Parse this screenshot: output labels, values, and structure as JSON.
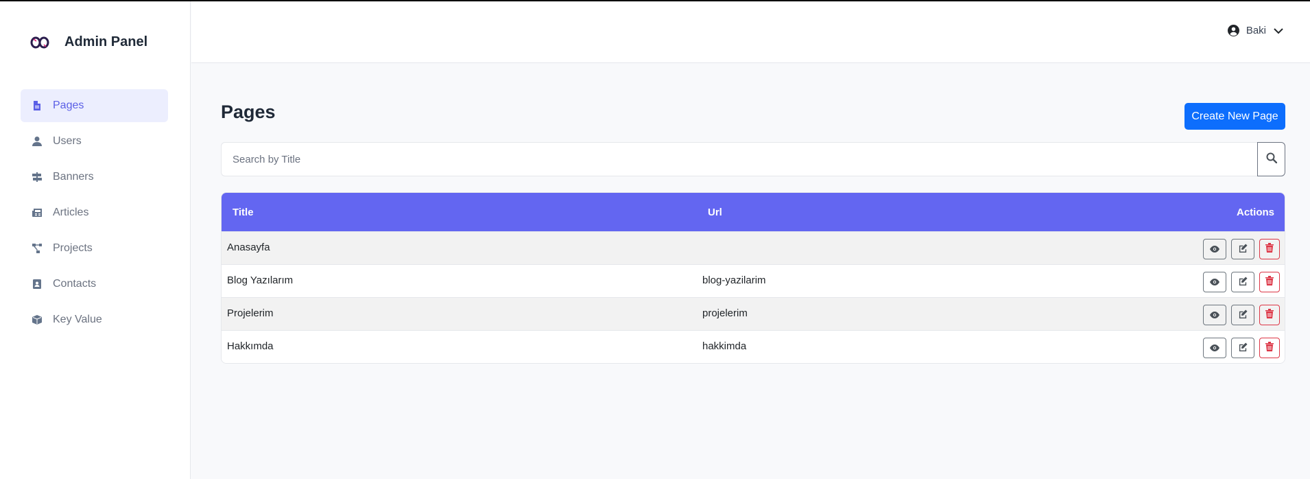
{
  "brand": {
    "title": "Admin Panel",
    "logo_icon": "infinity-logo-icon"
  },
  "sidebar": {
    "items": [
      {
        "label": "Pages",
        "icon": "file-icon",
        "active": true
      },
      {
        "label": "Users",
        "icon": "user-icon",
        "active": false
      },
      {
        "label": "Banners",
        "icon": "signs-icon",
        "active": false
      },
      {
        "label": "Articles",
        "icon": "newspaper-icon",
        "active": false
      },
      {
        "label": "Projects",
        "icon": "diagram-icon",
        "active": false
      },
      {
        "label": "Contacts",
        "icon": "address-book-icon",
        "active": false
      },
      {
        "label": "Key Value",
        "icon": "cube-icon",
        "active": false
      }
    ]
  },
  "header": {
    "user_name": "Baki"
  },
  "main": {
    "title": "Pages",
    "create_button": "Create New Page",
    "search": {
      "placeholder": "Search by Title",
      "value": ""
    },
    "table": {
      "columns": [
        "Title",
        "Url",
        "Actions"
      ],
      "rows": [
        {
          "title": "Anasayfa",
          "url": ""
        },
        {
          "title": "Blog Yazılarım",
          "url": "blog-yazilarim"
        },
        {
          "title": "Projelerim",
          "url": "projelerim"
        },
        {
          "title": "Hakkımda",
          "url": "hakkimda"
        }
      ]
    }
  },
  "colors": {
    "accent": "#6366f1",
    "primary": "#0d6efd",
    "danger": "#dc3545",
    "active_bg": "#eceefe"
  }
}
